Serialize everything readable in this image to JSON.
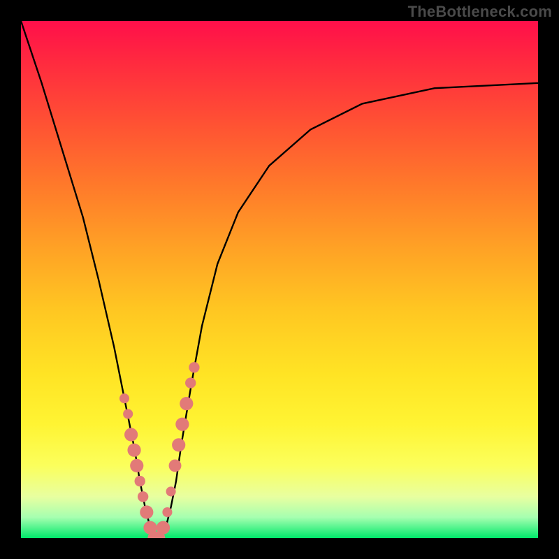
{
  "watermark": "TheBottleneck.com",
  "chart_data": {
    "type": "line",
    "title": "",
    "xlabel": "",
    "ylabel": "",
    "xlim": [
      0,
      100
    ],
    "ylim": [
      0,
      100
    ],
    "series": [
      {
        "name": "bottleneck-curve",
        "x": [
          0,
          4,
          8,
          12,
          15,
          18,
          20,
          22,
          23,
          24,
          25,
          26,
          27,
          28,
          29,
          30,
          31,
          33,
          35,
          38,
          42,
          48,
          56,
          66,
          80,
          100
        ],
        "values": [
          100,
          88,
          75,
          62,
          50,
          37,
          27,
          17,
          11,
          6,
          2,
          0,
          0,
          2,
          6,
          11,
          18,
          30,
          41,
          53,
          63,
          72,
          79,
          84,
          87,
          88
        ]
      }
    ],
    "markers": [
      {
        "x": 20.0,
        "y": 27,
        "size": 2.2
      },
      {
        "x": 20.7,
        "y": 24,
        "size": 2.2
      },
      {
        "x": 21.3,
        "y": 20,
        "size": 3.0
      },
      {
        "x": 21.9,
        "y": 17,
        "size": 3.0
      },
      {
        "x": 22.4,
        "y": 14,
        "size": 3.0
      },
      {
        "x": 23.0,
        "y": 11,
        "size": 2.4
      },
      {
        "x": 23.6,
        "y": 8,
        "size": 2.4
      },
      {
        "x": 24.3,
        "y": 5,
        "size": 3.0
      },
      {
        "x": 25.0,
        "y": 2,
        "size": 3.0
      },
      {
        "x": 25.8,
        "y": 0,
        "size": 3.0
      },
      {
        "x": 26.6,
        "y": 0,
        "size": 3.0
      },
      {
        "x": 27.5,
        "y": 2,
        "size": 3.0
      },
      {
        "x": 28.3,
        "y": 5,
        "size": 2.2
      },
      {
        "x": 29.0,
        "y": 9,
        "size": 2.2
      },
      {
        "x": 29.8,
        "y": 14,
        "size": 2.8
      },
      {
        "x": 30.5,
        "y": 18,
        "size": 3.0
      },
      {
        "x": 31.2,
        "y": 22,
        "size": 3.0
      },
      {
        "x": 32.0,
        "y": 26,
        "size": 3.0
      },
      {
        "x": 32.8,
        "y": 30,
        "size": 2.4
      },
      {
        "x": 33.5,
        "y": 33,
        "size": 2.4
      }
    ],
    "marker_color": "#e27a78",
    "curve_color": "#000000",
    "background_gradient": {
      "top": "#ff0f4a",
      "middle": "#ffe324",
      "bottom": "#00e86b"
    }
  }
}
